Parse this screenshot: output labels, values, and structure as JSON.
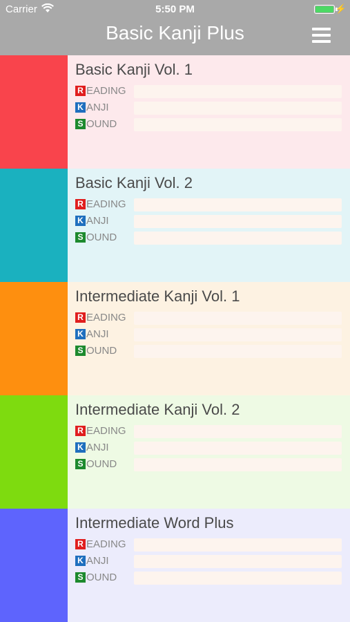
{
  "status": {
    "carrier": "Carrier",
    "time": "5:50 PM"
  },
  "header": {
    "title": "Basic Kanji Plus"
  },
  "colors": {
    "reading": "#e01e1e",
    "kanji": "#1f6fbe",
    "sound": "#1d8a2e"
  },
  "courses": [
    {
      "name": "Basic Kanji Vol. 1",
      "color": "#f9444c",
      "bg": "#fde9ec",
      "rows": [
        {
          "letter": "R",
          "rest": "EADING"
        },
        {
          "letter": "K",
          "rest": "ANJI"
        },
        {
          "letter": "S",
          "rest": "OUND"
        }
      ]
    },
    {
      "name": "Basic Kanji Vol. 2",
      "color": "#1ab1bf",
      "bg": "#e2f4f7",
      "rows": [
        {
          "letter": "R",
          "rest": "EADING"
        },
        {
          "letter": "K",
          "rest": "ANJI"
        },
        {
          "letter": "S",
          "rest": "OUND"
        }
      ]
    },
    {
      "name": "Intermediate Kanji Vol. 1",
      "color": "#fe8f0f",
      "bg": "#fdf2e2",
      "rows": [
        {
          "letter": "R",
          "rest": "EADING"
        },
        {
          "letter": "K",
          "rest": "ANJI"
        },
        {
          "letter": "S",
          "rest": "OUND"
        }
      ]
    },
    {
      "name": "Intermediate Kanji Vol. 2",
      "color": "#7edb0f",
      "bg": "#eefae4",
      "rows": [
        {
          "letter": "R",
          "rest": "EADING"
        },
        {
          "letter": "K",
          "rest": "ANJI"
        },
        {
          "letter": "S",
          "rest": "OUND"
        }
      ]
    },
    {
      "name": "Intermediate Word Plus",
      "color": "#5e64fd",
      "bg": "#ececfc",
      "rows": [
        {
          "letter": "R",
          "rest": "EADING"
        },
        {
          "letter": "K",
          "rest": "ANJI"
        },
        {
          "letter": "S",
          "rest": "OUND"
        }
      ]
    }
  ]
}
